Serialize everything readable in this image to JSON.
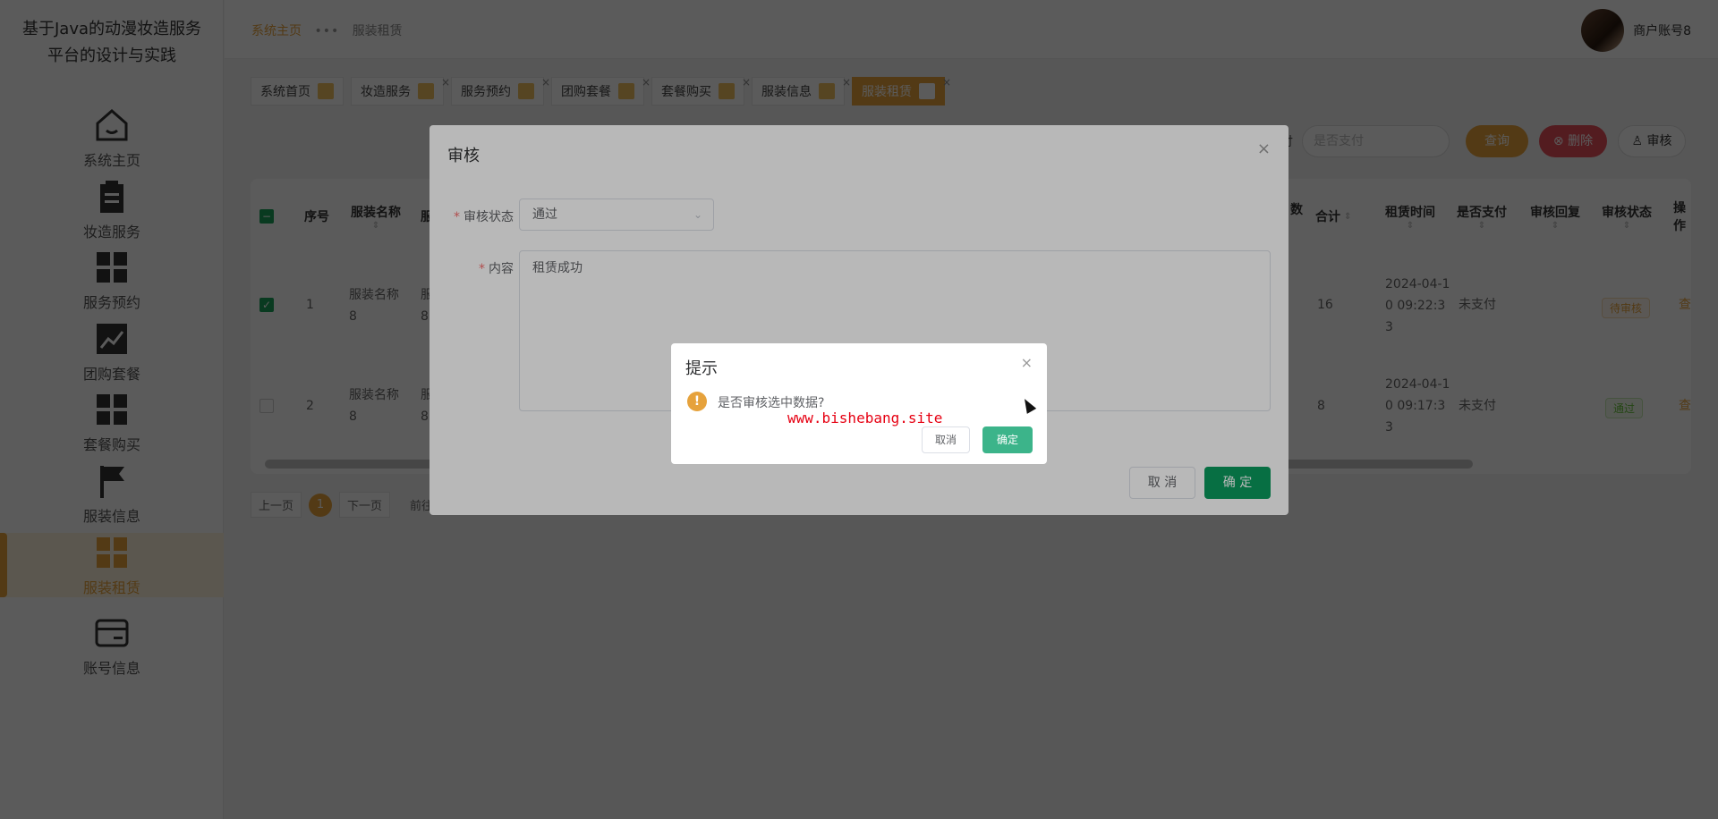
{
  "app_title": "基于Java的动漫妆造服务平台的设计与实践",
  "sidebar": {
    "items": [
      {
        "label": "系统主页",
        "icon": "home-icon"
      },
      {
        "label": "妆造服务",
        "icon": "clipboard-icon"
      },
      {
        "label": "服务预约",
        "icon": "grid-icon"
      },
      {
        "label": "团购套餐",
        "icon": "chart-line-icon"
      },
      {
        "label": "套餐购买",
        "icon": "grid-icon"
      },
      {
        "label": "服装信息",
        "icon": "flag-icon"
      },
      {
        "label": "服装租赁",
        "icon": "grid-icon"
      },
      {
        "label": "账号信息",
        "icon": "card-icon"
      }
    ],
    "active_index": 6
  },
  "header": {
    "breadcrumb_home": "系统主页",
    "breadcrumb_sep": "•••",
    "breadcrumb_current": "服装租赁",
    "user_name": "商户账号8"
  },
  "tabs": [
    "系统首页",
    "妆造服务",
    "服务预约",
    "团购套餐",
    "套餐购买",
    "服装信息",
    "服装租赁"
  ],
  "toolbar": {
    "label": "付",
    "select_placeholder": "是否支付",
    "query": "查询",
    "delete": "删除",
    "audit": "审核"
  },
  "table": {
    "headers": {
      "seq": "序号",
      "name": "服装名称",
      "name2": "服",
      "num": "数",
      "total": "合计",
      "time": "租赁时间",
      "paid": "是否支付",
      "reply": "审核回复",
      "status": "审核状态",
      "op": "操作"
    },
    "rows": [
      {
        "seq": "1",
        "name": "服装名称8",
        "name2": "服8",
        "total": "16",
        "time": "2024-04-10 09:22:33",
        "paid": "未支付",
        "status": "待审核",
        "op": "查"
      },
      {
        "seq": "2",
        "name": "服装名称8",
        "name2": "服8",
        "total": "8",
        "time": "2024-04-10 09:17:33",
        "paid": "未支付",
        "status": "通过",
        "op": "查"
      }
    ]
  },
  "pager": {
    "prev": "上一页",
    "page": "1",
    "next": "下一页",
    "goto": "前往"
  },
  "dialog": {
    "title": "审核",
    "status_label": "审核状态",
    "status_value": "通过",
    "content_label": "内容",
    "content_value": "租赁成功",
    "cancel": "取 消",
    "ok": "确 定"
  },
  "msgbox": {
    "title": "提示",
    "message": "是否审核选中数据?",
    "watermark": "www.bishebang.site",
    "cancel": "取消",
    "ok": "确定"
  }
}
